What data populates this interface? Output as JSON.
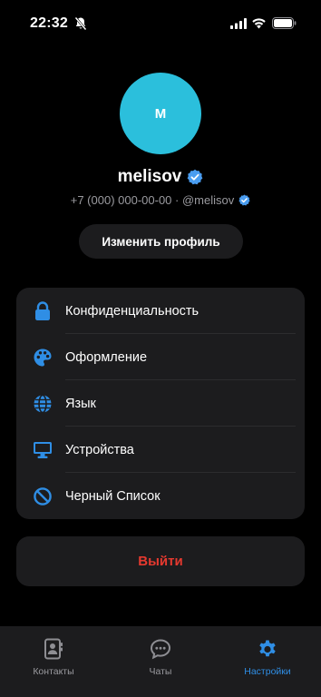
{
  "status_bar": {
    "time": "22:32"
  },
  "profile": {
    "avatar_initial": "M",
    "name": "melisov",
    "subtitle": "+7 (000) 000-00-00 · @melisov",
    "edit_button_label": "Изменить профиль"
  },
  "settings": {
    "items": [
      {
        "label": "Конфиденциальность",
        "icon": "lock-icon"
      },
      {
        "label": "Оформление",
        "icon": "palette-icon"
      },
      {
        "label": "Язык",
        "icon": "globe-icon"
      },
      {
        "label": "Устройства",
        "icon": "monitor-icon"
      },
      {
        "label": "Черный Список",
        "icon": "block-icon"
      }
    ]
  },
  "logout_label": "Выйти",
  "tabs": [
    {
      "label": "Контакты",
      "icon": "contacts-icon",
      "active": false
    },
    {
      "label": "Чаты",
      "icon": "chat-icon",
      "active": false
    },
    {
      "label": "Настройки",
      "icon": "gear-icon",
      "active": true
    }
  ],
  "colors": {
    "accent": "#2f8ee5",
    "avatar_bg": "#2bbfdc",
    "danger": "#e5392f",
    "card_bg": "#1c1c1e"
  }
}
